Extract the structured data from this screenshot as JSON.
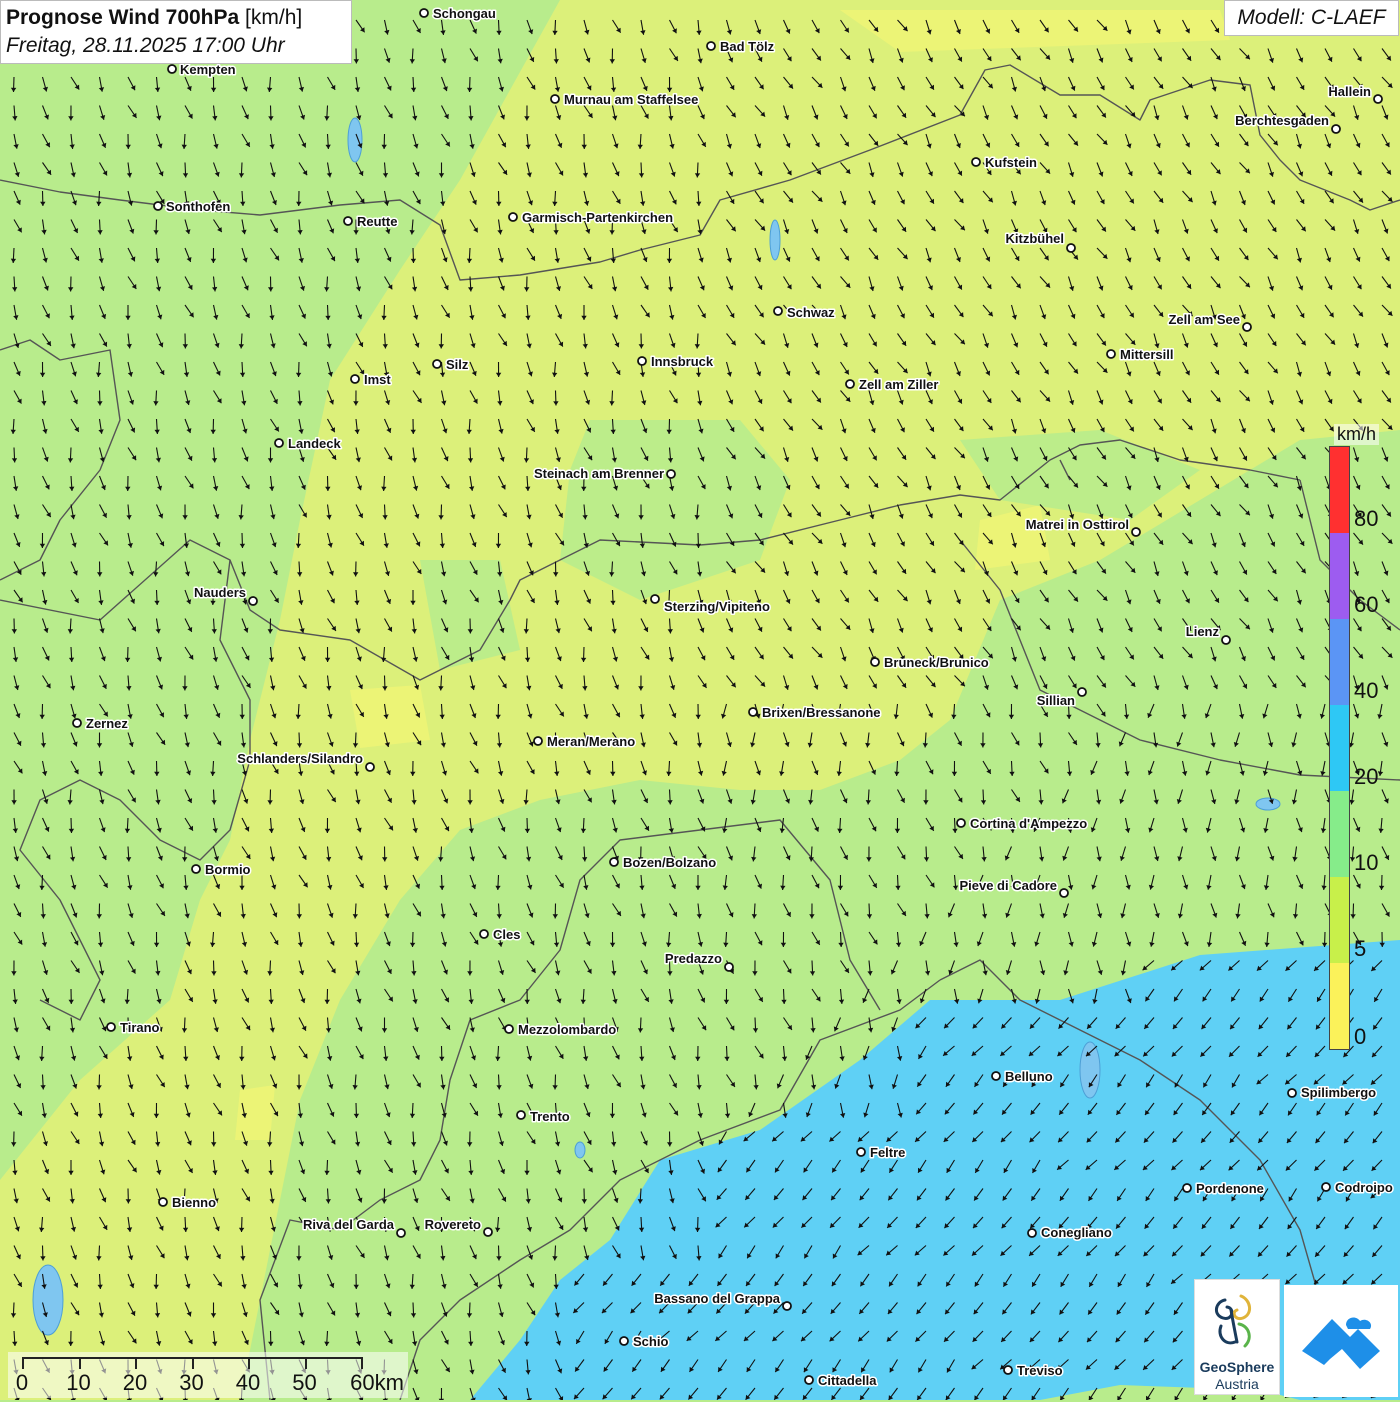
{
  "title": {
    "main": "Prognose Wind 700hPa",
    "unit": "[km/h]",
    "datetime": "Freitag, 28.11.2025 17:00 Uhr"
  },
  "model": "Modell: C-LAEF",
  "legend": {
    "unit": "km/h",
    "ticks": [
      "80",
      "60",
      "40",
      "20",
      "10",
      "5",
      "0"
    ],
    "colors": [
      "#ff3030",
      "#9d5cf0",
      "#5b95f5",
      "#2ec8f5",
      "#86ec8a",
      "#c8f04a",
      "#fbf25a"
    ]
  },
  "scale": {
    "labels": [
      "0",
      "10",
      "20",
      "30",
      "40",
      "50",
      "60km"
    ]
  },
  "logos": {
    "geosphere_line1": "GeoSphere",
    "geosphere_line2": "Austria"
  },
  "cities": [
    {
      "name": "Schongau"
    },
    {
      "name": "Bad Tölz"
    },
    {
      "name": "Kempten"
    },
    {
      "name": "Murnau am Staffelsee"
    },
    {
      "name": "Hallein"
    },
    {
      "name": "Berchtesgaden"
    },
    {
      "name": "Kufstein"
    },
    {
      "name": "Sonthofen"
    },
    {
      "name": "Reutte"
    },
    {
      "name": "Garmisch-Partenkirchen"
    },
    {
      "name": "Kitzbühel"
    },
    {
      "name": "Schwaz"
    },
    {
      "name": "Zell am See"
    },
    {
      "name": "Mittersill"
    },
    {
      "name": "Silz"
    },
    {
      "name": "Innsbruck"
    },
    {
      "name": "Imst"
    },
    {
      "name": "Zell am Ziller"
    },
    {
      "name": "Landeck"
    },
    {
      "name": "Steinach am Brenner"
    },
    {
      "name": "Matrei in Osttirol"
    },
    {
      "name": "Nauders"
    },
    {
      "name": "Sterzing/Vipiteno"
    },
    {
      "name": "Lienz"
    },
    {
      "name": "Bruneck/Brunico"
    },
    {
      "name": "Sillian"
    },
    {
      "name": "Zernez"
    },
    {
      "name": "Brixen/Bressanone"
    },
    {
      "name": "Meran/Merano"
    },
    {
      "name": "Schlanders/Silandro"
    },
    {
      "name": "Cortina d'Ampezzo"
    },
    {
      "name": "Bozen/Bolzano"
    },
    {
      "name": "Bormio"
    },
    {
      "name": "Pieve di Cadore"
    },
    {
      "name": "Cles"
    },
    {
      "name": "Predazzo"
    },
    {
      "name": "Tirano"
    },
    {
      "name": "Mezzolombardo"
    },
    {
      "name": "Belluno"
    },
    {
      "name": "Spilimbergo"
    },
    {
      "name": "Trento"
    },
    {
      "name": "Feltre"
    },
    {
      "name": "Pordenone"
    },
    {
      "name": "Codroipo"
    },
    {
      "name": "Bienno"
    },
    {
      "name": "Riva del Garda"
    },
    {
      "name": "Rovereto"
    },
    {
      "name": "Conegliano"
    },
    {
      "name": "Bassano del Grappa"
    },
    {
      "name": "Schio"
    },
    {
      "name": "Treviso"
    },
    {
      "name": "Cittadella"
    }
  ]
}
